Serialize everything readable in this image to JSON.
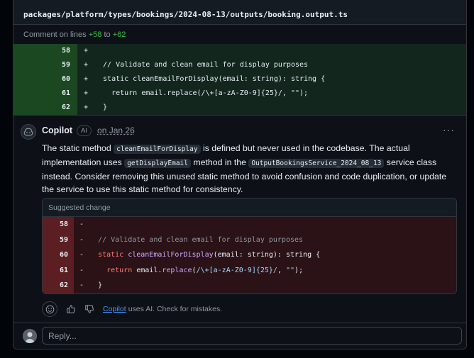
{
  "file": {
    "path": "packages/platform/types/bookings/2024-08-13/outputs/booking.output.ts"
  },
  "comment_range": {
    "prefix": "Comment on lines",
    "start": "+58",
    "joiner": "to",
    "end": "+62"
  },
  "diff_lines": [
    {
      "num": "58",
      "sign": "+",
      "code": ""
    },
    {
      "num": "59",
      "sign": "+",
      "code": "  // Validate and clean email for display purposes"
    },
    {
      "num": "60",
      "sign": "+",
      "code": "  static cleanEmailForDisplay(email: string): string {"
    },
    {
      "num": "61",
      "sign": "+",
      "code": "    return email.replace(/\\+[a-zA-Z0-9]{25}/, \"\");"
    },
    {
      "num": "62",
      "sign": "+",
      "code": "  }"
    }
  ],
  "comment": {
    "author": "Copilot",
    "badge": "AI",
    "date": "on Jan 26",
    "more": "···",
    "body": {
      "t1": "The static method ",
      "c1": "cleanEmailForDisplay",
      "t2": " is defined but never used in the codebase. The actual implementation uses ",
      "c2": "getDisplayEmail",
      "t3": " method in the ",
      "c3": "OutputBookingsService_2024_08_13",
      "t4": " service class instead. Consider removing this unused static method to avoid confusion and code duplication, or update the service to use this static method for consistency."
    },
    "suggestion": {
      "header": "Suggested change",
      "lines": [
        {
          "num": "58",
          "sign": "-"
        },
        {
          "num": "59",
          "sign": "-",
          "comment": "// Validate and clean email for display purposes"
        },
        {
          "num": "60",
          "sign": "-",
          "kw": "static",
          "fn": "cleanEmailForDisplay",
          "rest": "(email: string): string {"
        },
        {
          "num": "61",
          "sign": "-",
          "kw": "return",
          "obj": "email.",
          "fn": "replace",
          "p1": "(",
          "re": "/\\+[a-zA-Z0-9]{25}/",
          "p2": ", ",
          "str": "\"\"",
          "p3": ");"
        },
        {
          "num": "62",
          "sign": "-",
          "rest": "}"
        }
      ]
    },
    "footer": {
      "link": "Copilot",
      "text": "uses AI. Check for mistakes."
    }
  },
  "reply": {
    "placeholder": "Reply..."
  },
  "colors": {
    "add_bg": "#12261e",
    "del_bg": "#2a1216",
    "link": "#4493f8"
  }
}
